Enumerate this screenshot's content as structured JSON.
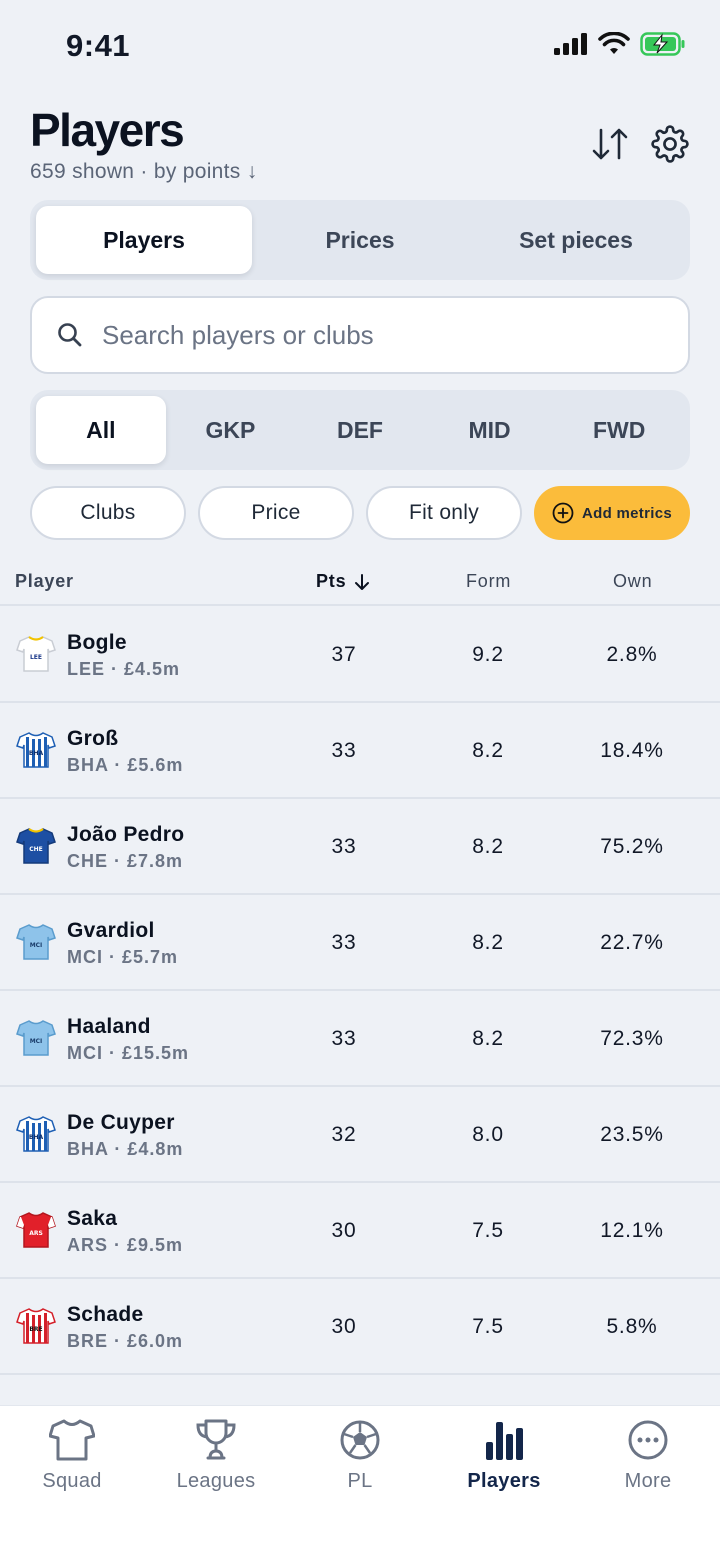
{
  "status": {
    "time": "9:41"
  },
  "header": {
    "title": "Players",
    "subtitle": "659 shown · by points ↓"
  },
  "tabs": [
    {
      "label": "Players",
      "active": true
    },
    {
      "label": "Prices",
      "active": false
    },
    {
      "label": "Set pieces",
      "active": false
    }
  ],
  "search": {
    "placeholder": "Search players or clubs",
    "value": ""
  },
  "positions": [
    {
      "label": "All",
      "active": true
    },
    {
      "label": "GKP",
      "active": false
    },
    {
      "label": "DEF",
      "active": false
    },
    {
      "label": "MID",
      "active": false
    },
    {
      "label": "FWD",
      "active": false
    }
  ],
  "filters": {
    "clubs": "Clubs",
    "price": "Price",
    "fit_only": "Fit only",
    "add_metrics": "Add metrics"
  },
  "table": {
    "headers": {
      "player": "Player",
      "pts": "Pts",
      "form": "Form",
      "own": "Own"
    },
    "rows": [
      {
        "name": "Bogle",
        "meta": "LEE · £4.5m",
        "kit": "LEE",
        "pts": "37",
        "form": "9.2",
        "own": "2.8%"
      },
      {
        "name": "Groß",
        "meta": "BHA · £5.6m",
        "kit": "BHA",
        "pts": "33",
        "form": "8.2",
        "own": "18.4%"
      },
      {
        "name": "João Pedro",
        "meta": "CHE · £7.8m",
        "kit": "CHE",
        "pts": "33",
        "form": "8.2",
        "own": "75.2%"
      },
      {
        "name": "Gvardiol",
        "meta": "MCI · £5.7m",
        "kit": "MCI",
        "pts": "33",
        "form": "8.2",
        "own": "22.7%"
      },
      {
        "name": "Haaland",
        "meta": "MCI · £15.5m",
        "kit": "MCI",
        "pts": "33",
        "form": "8.2",
        "own": "72.3%"
      },
      {
        "name": "De Cuyper",
        "meta": "BHA · £4.8m",
        "kit": "BHA",
        "pts": "32",
        "form": "8.0",
        "own": "23.5%"
      },
      {
        "name": "Saka",
        "meta": "ARS · £9.5m",
        "kit": "ARS",
        "pts": "30",
        "form": "7.5",
        "own": "12.1%"
      },
      {
        "name": "Schade",
        "meta": "BRE · £6.0m",
        "kit": "BRE",
        "pts": "30",
        "form": "7.5",
        "own": "5.8%"
      }
    ]
  },
  "nav": [
    {
      "label": "Squad",
      "icon": "shirt-icon"
    },
    {
      "label": "Leagues",
      "icon": "trophy-icon"
    },
    {
      "label": "PL",
      "icon": "football-icon"
    },
    {
      "label": "Players",
      "icon": "bar-chart-icon",
      "active": true
    },
    {
      "label": "More",
      "icon": "more-icon"
    }
  ],
  "colors": {
    "accent": "#fbbc3b",
    "nav_active": "#13264a",
    "background": "#eef1f6"
  }
}
